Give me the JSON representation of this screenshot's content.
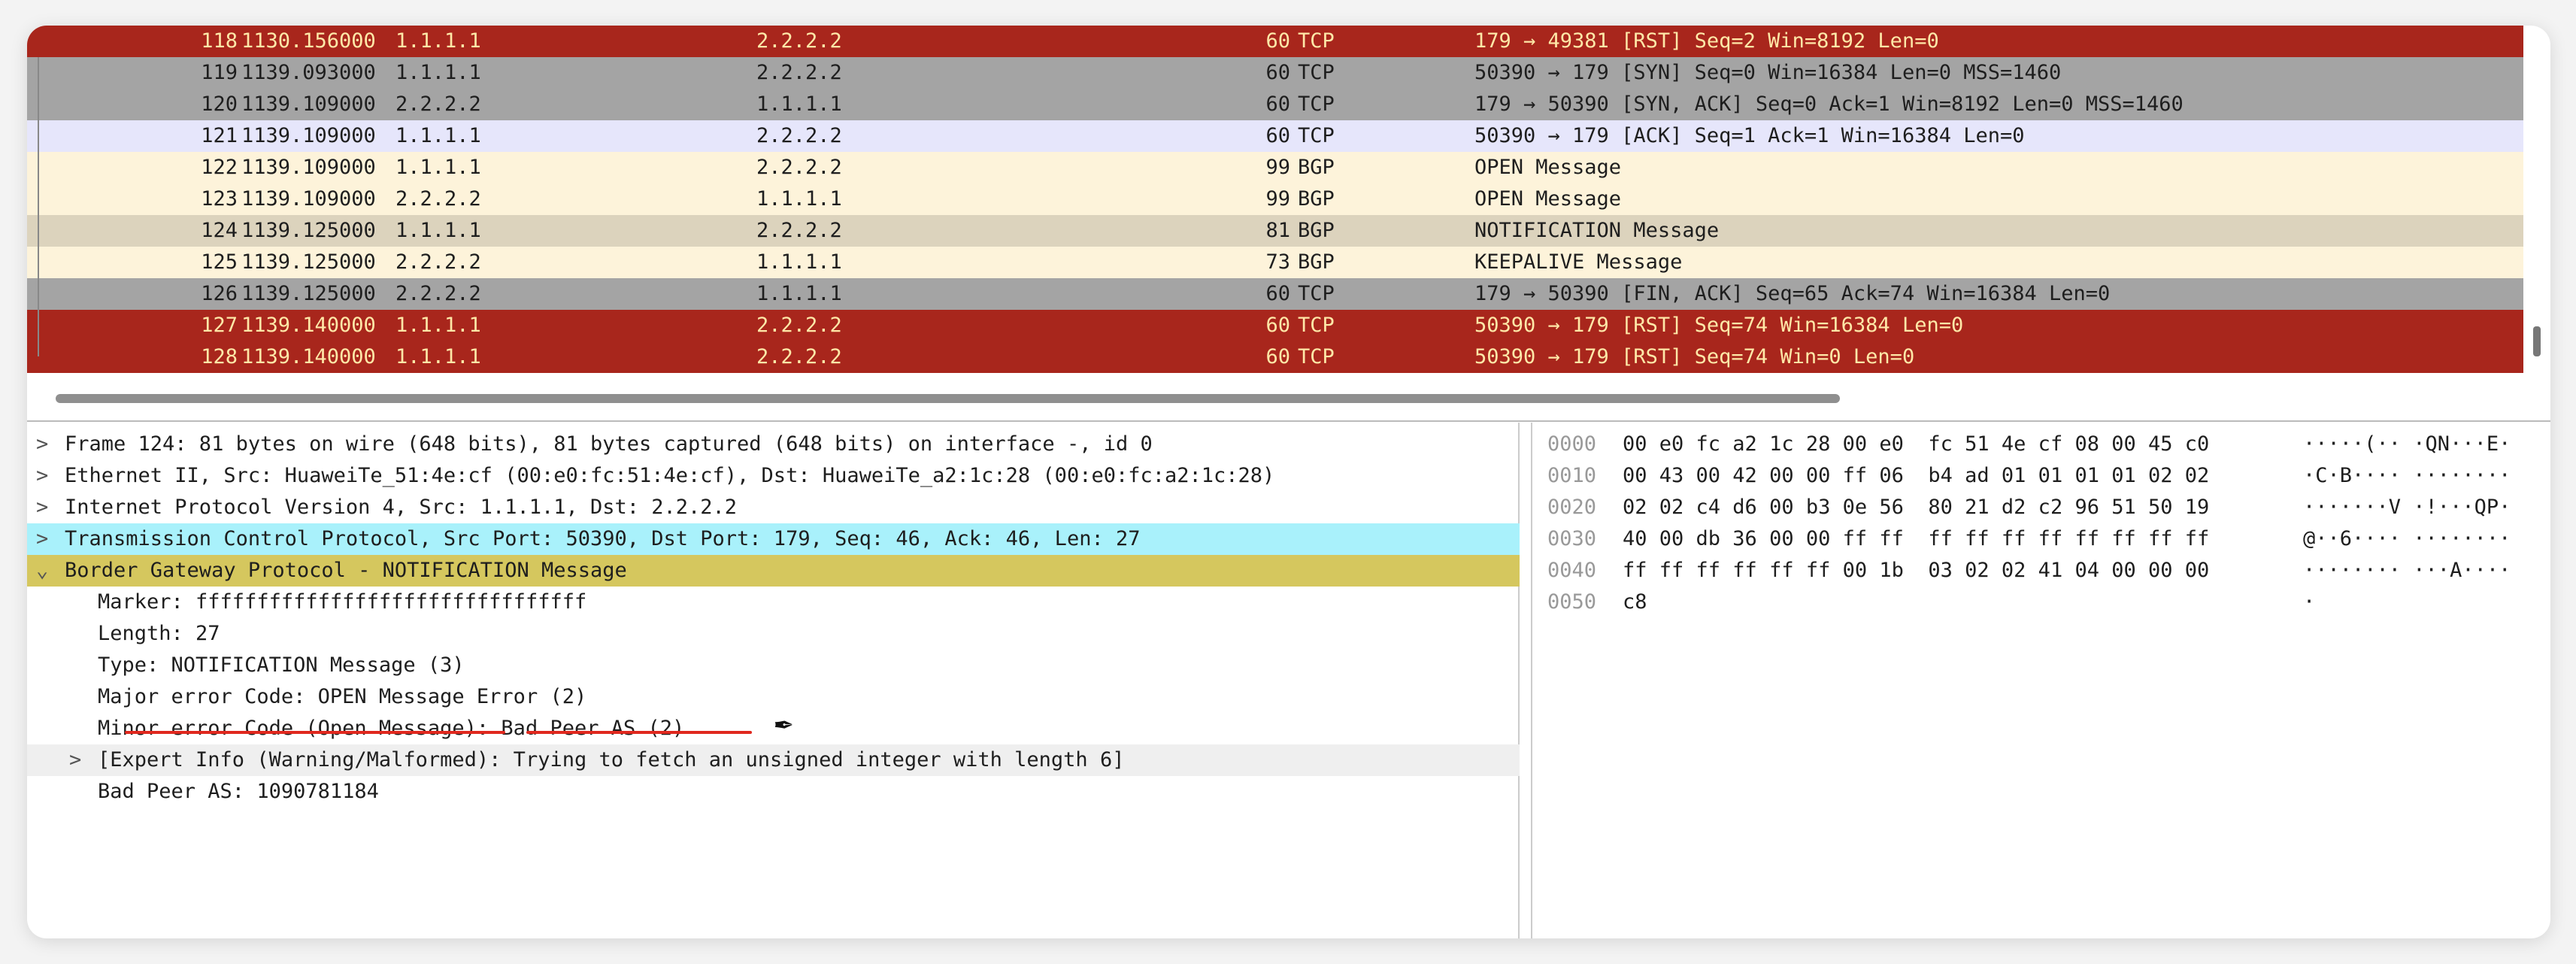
{
  "colors": {
    "rst_row": "#a8261c",
    "syn_row": "#a4a4a4",
    "ack_row": "#e6e6fb",
    "bgp_row": "#fdf3da",
    "selected_row": "#dcd3bd",
    "tcp_detail": "#a9f1fb",
    "bgp_detail": "#d5c75e",
    "annotation": "#e0281e"
  },
  "packets": [
    {
      "no": "118",
      "time": "1130.156000",
      "src": "1.1.1.1",
      "dst": "2.2.2.2",
      "len": "60",
      "proto": "TCP",
      "info": "179 → 49381 [RST] Seq=2 Win=8192 Len=0",
      "style": "red"
    },
    {
      "no": "119",
      "time": "1139.093000",
      "src": "1.1.1.1",
      "dst": "2.2.2.2",
      "len": "60",
      "proto": "TCP",
      "info": "50390 → 179 [SYN] Seq=0 Win=16384 Len=0 MSS=1460",
      "style": "gray"
    },
    {
      "no": "120",
      "time": "1139.109000",
      "src": "2.2.2.2",
      "dst": "1.1.1.1",
      "len": "60",
      "proto": "TCP",
      "info": "179 → 50390 [SYN, ACK] Seq=0 Ack=1 Win=8192 Len=0 MSS=1460",
      "style": "gray"
    },
    {
      "no": "121",
      "time": "1139.109000",
      "src": "1.1.1.1",
      "dst": "2.2.2.2",
      "len": "60",
      "proto": "TCP",
      "info": "50390 → 179 [ACK] Seq=1 Ack=1 Win=16384 Len=0",
      "style": "lav"
    },
    {
      "no": "122",
      "time": "1139.109000",
      "src": "1.1.1.1",
      "dst": "2.2.2.2",
      "len": "99",
      "proto": "BGP",
      "info": "OPEN Message",
      "style": "cream"
    },
    {
      "no": "123",
      "time": "1139.109000",
      "src": "2.2.2.2",
      "dst": "1.1.1.1",
      "len": "99",
      "proto": "BGP",
      "info": "OPEN Message",
      "style": "cream"
    },
    {
      "no": "124",
      "time": "1139.125000",
      "src": "1.1.1.1",
      "dst": "2.2.2.2",
      "len": "81",
      "proto": "BGP",
      "info": "NOTIFICATION Message",
      "style": "tan"
    },
    {
      "no": "125",
      "time": "1139.125000",
      "src": "2.2.2.2",
      "dst": "1.1.1.1",
      "len": "73",
      "proto": "BGP",
      "info": "KEEPALIVE Message",
      "style": "cream"
    },
    {
      "no": "126",
      "time": "1139.125000",
      "src": "2.2.2.2",
      "dst": "1.1.1.1",
      "len": "60",
      "proto": "TCP",
      "info": "179 → 50390 [FIN, ACK] Seq=65 Ack=74 Win=16384 Len=0",
      "style": "gray"
    },
    {
      "no": "127",
      "time": "1139.140000",
      "src": "1.1.1.1",
      "dst": "2.2.2.2",
      "len": "60",
      "proto": "TCP",
      "info": "50390 → 179 [RST] Seq=74 Win=16384 Len=0",
      "style": "red"
    },
    {
      "no": "128",
      "time": "1139.140000",
      "src": "1.1.1.1",
      "dst": "2.2.2.2",
      "len": "60",
      "proto": "TCP",
      "info": "50390 → 179 [RST] Seq=74 Win=0 Len=0",
      "style": "red"
    }
  ],
  "details": [
    {
      "arrow": ">",
      "text": "Frame 124: 81 bytes on wire (648 bits), 81 bytes captured (648 bits) on interface -, id 0",
      "style": "",
      "sub": false
    },
    {
      "arrow": ">",
      "text": "Ethernet II, Src: HuaweiTe_51:4e:cf (00:e0:fc:51:4e:cf), Dst: HuaweiTe_a2:1c:28 (00:e0:fc:a2:1c:28)",
      "style": "",
      "sub": false
    },
    {
      "arrow": ">",
      "text": "Internet Protocol Version 4, Src: 1.1.1.1, Dst: 2.2.2.2",
      "style": "",
      "sub": false
    },
    {
      "arrow": ">",
      "text": "Transmission Control Protocol, Src Port: 50390, Dst Port: 179, Seq: 46, Ack: 46, Len: 27",
      "style": "cyan",
      "sub": false
    },
    {
      "arrow": "⌄",
      "text": "Border Gateway Protocol - NOTIFICATION Message",
      "style": "olive",
      "sub": false
    },
    {
      "arrow": "",
      "text": "Marker: ffffffffffffffffffffffffffffffff",
      "style": "",
      "sub": true
    },
    {
      "arrow": "",
      "text": "Length: 27",
      "style": "",
      "sub": true
    },
    {
      "arrow": "",
      "text": "Type: NOTIFICATION Message (3)",
      "style": "",
      "sub": true
    },
    {
      "arrow": "",
      "text": "Major error Code: OPEN Message Error (2)",
      "style": "",
      "sub": true
    },
    {
      "arrow": "",
      "text": "Minor error Code (Open Message): Bad Peer AS (2)",
      "style": "",
      "sub": true
    },
    {
      "arrow": ">",
      "text": "[Expert Info (Warning/Malformed): Trying to fetch an unsigned integer with length 6]",
      "style": "exp",
      "sub": true
    },
    {
      "arrow": "",
      "text": "Bad Peer AS: 1090781184",
      "style": "",
      "sub": true
    }
  ],
  "hex": [
    {
      "off": "0000",
      "bytes": "00 e0 fc a2 1c 28 00 e0  fc 51 4e cf 08 00 45 c0",
      "ascii": "·····(·· ·QN···E·"
    },
    {
      "off": "0010",
      "bytes": "00 43 00 42 00 00 ff 06  b4 ad 01 01 01 01 02 02",
      "ascii": "·C·B···· ········"
    },
    {
      "off": "0020",
      "bytes": "02 02 c4 d6 00 b3 0e 56  80 21 d2 c2 96 51 50 19",
      "ascii": "·······V ·!···QP·"
    },
    {
      "off": "0030",
      "bytes": "40 00 db 36 00 00 ff ff  ff ff ff ff ff ff ff ff",
      "ascii": "@··6···· ········"
    },
    {
      "off": "0040",
      "bytes": "ff ff ff ff ff ff 00 1b  03 02 02 41 04 00 00 00",
      "ascii": "········ ···A····"
    },
    {
      "off": "0050",
      "bytes": "c8",
      "ascii": "·"
    }
  ],
  "icons": {
    "annotation_cursor": "pen-icon"
  }
}
